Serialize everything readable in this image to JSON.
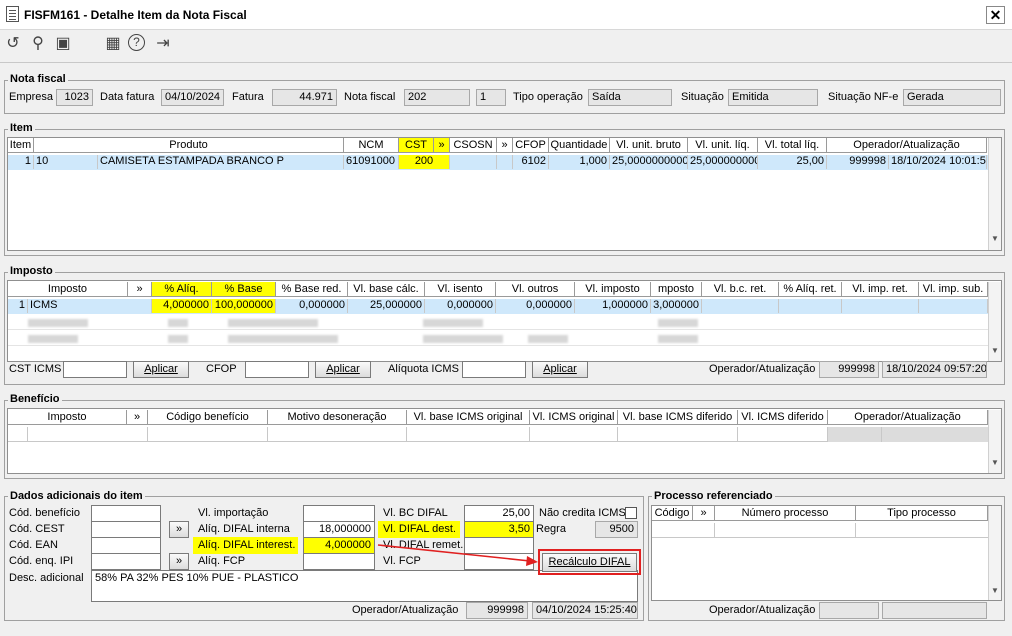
{
  "window": {
    "title": "FISFM161 - Detalhe Item da Nota Fiscal",
    "close": "✕"
  },
  "toolbar": {
    "undo_icon": "↺",
    "search_icon": "⚲",
    "save_icon": "▣",
    "calendar_icon": "▦",
    "help_icon": "?",
    "exit_icon": "⇥"
  },
  "nota_fiscal": {
    "section": "Nota fiscal",
    "empresa_label": "Empresa",
    "empresa": "1023",
    "data_fatura_label": "Data fatura",
    "data_fatura": "04/10/2024",
    "fatura_label": "Fatura",
    "fatura": "44.971",
    "nota_fiscal_label": "Nota fiscal",
    "nota_fiscal": "202",
    "serie": "1",
    "tipo_operacao_label": "Tipo operação",
    "tipo_operacao": "Saída",
    "situacao_label": "Situação",
    "situacao": "Emitida",
    "situacao_nfe_label": "Situação NF-e",
    "situacao_nfe": "Gerada"
  },
  "item": {
    "section": "Item",
    "headers": [
      "Item",
      "Produto",
      "NCM",
      "CST",
      "»",
      "CSOSN",
      "»",
      "CFOP",
      "Quantidade",
      "Vl. unit. bruto",
      "Vl. unit. líq.",
      "Vl. total líq.",
      "Operador/Atualização"
    ],
    "row": [
      "1",
      "10",
      "CAMISETA ESTAMPADA BRANCO P",
      "61091000",
      "200",
      "",
      "",
      "",
      "6102",
      "1,000",
      "25,0000000000",
      "25,0000000000",
      "25,00",
      "999998",
      "18/10/2024 10:01:55"
    ]
  },
  "imposto": {
    "section": "Imposto",
    "headers": [
      "Imposto",
      "»",
      "% Alíq.",
      "% Base",
      "% Base red.",
      "Vl. base cálc.",
      "Vl. isento",
      "Vl. outros",
      "Vl. imposto",
      "mposto",
      "Vl. b.c. ret.",
      "% Alíq. ret.",
      "Vl. imp. ret.",
      "Vl. imp. sub."
    ],
    "row": [
      "1",
      "ICMS",
      "4,000000",
      "100,000000",
      "0,000000",
      "25,000000",
      "0,000000",
      "0,000000",
      "1,000000",
      "3,000000"
    ],
    "cst_icms_label": "CST ICMS",
    "cfop_label": "CFOP",
    "aliquota_icms_label": "Alíquota ICMS",
    "aplicar": "Aplicar",
    "operador_label": "Operador/Atualização",
    "operador": "999998",
    "atualizacao": "18/10/2024 09:57:20"
  },
  "beneficio": {
    "section": "Benefício",
    "headers": [
      "Imposto",
      "»",
      "Código benefício",
      "Motivo desoneração",
      "Vl. base ICMS original",
      "Vl. ICMS original",
      "Vl. base ICMS diferido",
      "Vl. ICMS diferido",
      "Operador/Atualização"
    ]
  },
  "dados": {
    "section": "Dados adicionais do item",
    "cod_beneficio_label": "Cód. benefício",
    "cod_cest_label": "Cód. CEST",
    "cod_ean_label": "Cód. EAN",
    "cod_enq_ipi_label": "Cód. enq. IPI",
    "desc_adicional_label": "Desc. adicional",
    "desc_adicional": "58% PA 32% PES 10% PUE - PLASTICO",
    "vl_importacao_label": "Vl. importação",
    "aliq_difal_interna_label": "Alíq. DIFAL interna",
    "aliq_difal_interna": "18,000000",
    "aliq_difal_interest_label": "Alíq. DIFAL interest.",
    "aliq_difal_interest": "4,000000",
    "aliq_fcp_label": "Alíq. FCP",
    "vl_bc_difal_label": "Vl. BC DIFAL",
    "vl_bc_difal": "25,00",
    "vl_difal_dest_label": "Vl. DIFAL dest.",
    "vl_difal_dest": "3,50",
    "vl_difal_remet_label": "Vl. DIFAL remet.",
    "vl_fcp_label": "Vl. FCP",
    "nao_credita_label": "Não credita ICMS",
    "regra_label": "Regra",
    "regra": "9500",
    "recalculo_btn": "Recálculo DIFAL",
    "operador_label": "Operador/Atualização",
    "operador": "999998",
    "atualizacao": "04/10/2024 15:25:40",
    "arrow_btn": "»"
  },
  "processo": {
    "section": "Processo referenciado",
    "headers": [
      "Código",
      "»",
      "Número processo",
      "Tipo processo"
    ],
    "operador_label": "Operador/Atualização"
  },
  "colors": {
    "highlight": "#ffff00",
    "selection": "#cfe8fb",
    "annotation": "#e02020"
  }
}
